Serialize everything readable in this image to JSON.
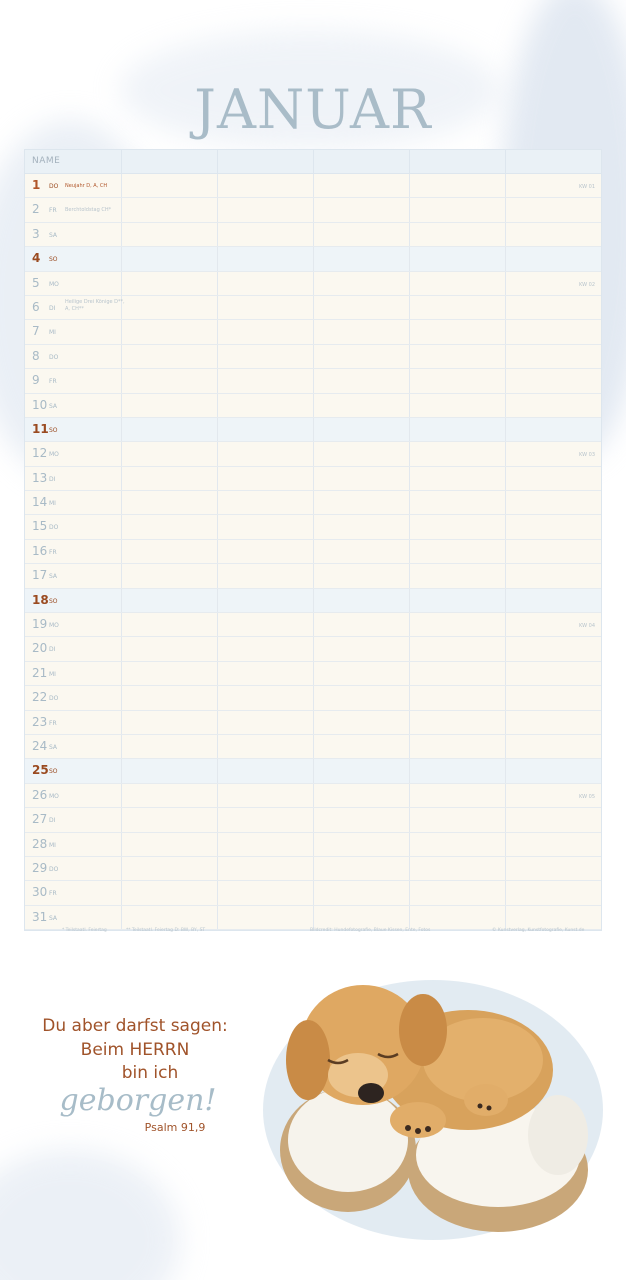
{
  "calendar": {
    "month": "Januar",
    "name_header": "NAME",
    "days": [
      {
        "num": "1",
        "wd": "DO",
        "note": "Neujahr D, A, CH",
        "kw": "KW 01",
        "type": "holiday"
      },
      {
        "num": "2",
        "wd": "FR",
        "note": "Berchtoldstag CH*",
        "kw": "",
        "type": "normal"
      },
      {
        "num": "3",
        "wd": "SA",
        "note": "",
        "kw": "",
        "type": "normal"
      },
      {
        "num": "4",
        "wd": "SO",
        "note": "",
        "kw": "",
        "type": "sun"
      },
      {
        "num": "5",
        "wd": "MO",
        "note": "",
        "kw": "KW 02",
        "type": "normal"
      },
      {
        "num": "6",
        "wd": "DI",
        "note": "Heilige Drei Könige D**, A, CH**",
        "kw": "",
        "type": "normal"
      },
      {
        "num": "7",
        "wd": "MI",
        "note": "",
        "kw": "",
        "type": "normal"
      },
      {
        "num": "8",
        "wd": "DO",
        "note": "",
        "kw": "",
        "type": "normal"
      },
      {
        "num": "9",
        "wd": "FR",
        "note": "",
        "kw": "",
        "type": "normal"
      },
      {
        "num": "10",
        "wd": "SA",
        "note": "",
        "kw": "",
        "type": "normal"
      },
      {
        "num": "11",
        "wd": "SO",
        "note": "",
        "kw": "",
        "type": "sun"
      },
      {
        "num": "12",
        "wd": "MO",
        "note": "",
        "kw": "KW 03",
        "type": "normal"
      },
      {
        "num": "13",
        "wd": "DI",
        "note": "",
        "kw": "",
        "type": "normal"
      },
      {
        "num": "14",
        "wd": "MI",
        "note": "",
        "kw": "",
        "type": "normal"
      },
      {
        "num": "15",
        "wd": "DO",
        "note": "",
        "kw": "",
        "type": "normal"
      },
      {
        "num": "16",
        "wd": "FR",
        "note": "",
        "kw": "",
        "type": "normal"
      },
      {
        "num": "17",
        "wd": "SA",
        "note": "",
        "kw": "",
        "type": "normal"
      },
      {
        "num": "18",
        "wd": "SO",
        "note": "",
        "kw": "",
        "type": "sun"
      },
      {
        "num": "19",
        "wd": "MO",
        "note": "",
        "kw": "KW 04",
        "type": "normal"
      },
      {
        "num": "20",
        "wd": "DI",
        "note": "",
        "kw": "",
        "type": "normal"
      },
      {
        "num": "21",
        "wd": "MI",
        "note": "",
        "kw": "",
        "type": "normal"
      },
      {
        "num": "22",
        "wd": "DO",
        "note": "",
        "kw": "",
        "type": "normal"
      },
      {
        "num": "23",
        "wd": "FR",
        "note": "",
        "kw": "",
        "type": "normal"
      },
      {
        "num": "24",
        "wd": "SA",
        "note": "",
        "kw": "",
        "type": "normal"
      },
      {
        "num": "25",
        "wd": "SO",
        "note": "",
        "kw": "",
        "type": "sun"
      },
      {
        "num": "26",
        "wd": "MO",
        "note": "",
        "kw": "KW 05",
        "type": "normal"
      },
      {
        "num": "27",
        "wd": "DI",
        "note": "",
        "kw": "",
        "type": "normal"
      },
      {
        "num": "28",
        "wd": "MI",
        "note": "",
        "kw": "",
        "type": "normal"
      },
      {
        "num": "29",
        "wd": "DO",
        "note": "",
        "kw": "",
        "type": "normal"
      },
      {
        "num": "30",
        "wd": "FR",
        "note": "",
        "kw": "",
        "type": "normal"
      },
      {
        "num": "31",
        "wd": "SA",
        "note": "",
        "kw": "",
        "type": "normal"
      }
    ]
  },
  "footer": {
    "note1": "* Teilstaatl. Feiertag",
    "note2": "** Teilstaatl. Feiertag D: BW, BY, ST",
    "credit1": "Bildcredit: Hundefotografie, Blaue Kissen, Ente, Fotos",
    "credit2": "© Kunstverlag, Kunstfotografie, Kunst.de"
  },
  "quote": {
    "line1": "Du aber darfst sagen:",
    "line2": "Beim HERRN",
    "line3": "bin ich",
    "line4": "geborgen!",
    "ref": "Psalm 91,9"
  },
  "colors": {
    "accent": "#a0532a",
    "title": "#a9bcc8",
    "grid_bg": "#fbf8f0",
    "sunday_bg": "#eef4f8"
  },
  "illustration": "sleeping-puppy-in-slippers"
}
